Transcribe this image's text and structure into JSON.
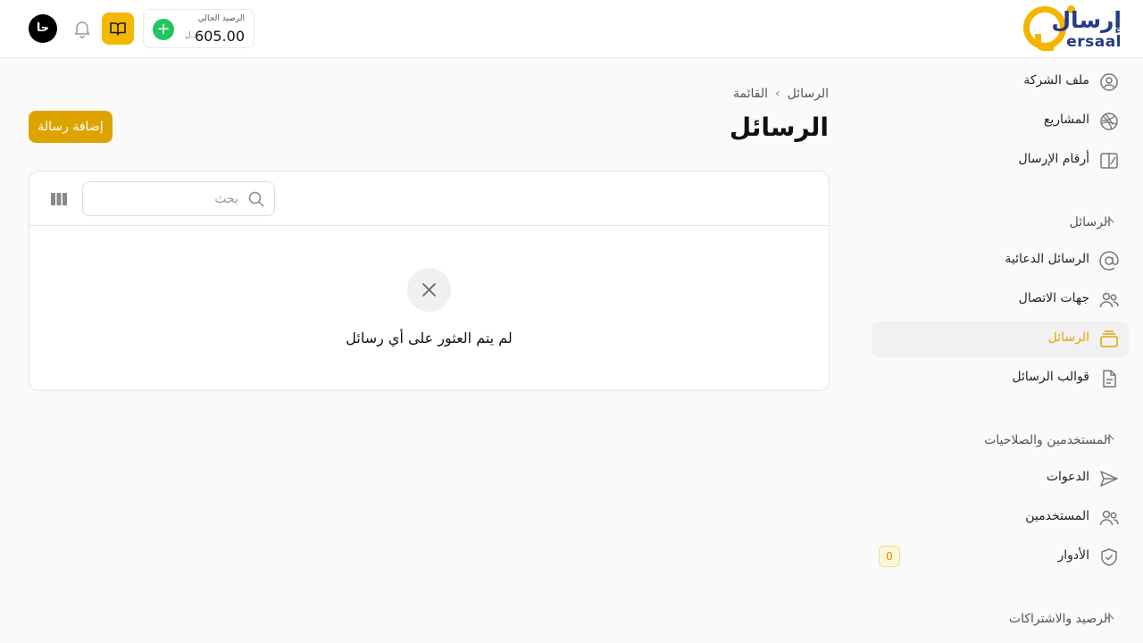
{
  "header": {
    "logo_ar": "إرسال",
    "logo_en": "ersaal",
    "balance_label": "الرصيد الحالي",
    "balance_value": "605.00",
    "currency": "د.ل",
    "avatar_initials": "حا",
    "accent_color": "#f5b800"
  },
  "sidebar": {
    "top_items": [
      {
        "label": "ملف الشركة",
        "icon": "user-circle-icon"
      },
      {
        "label": "المشاريع",
        "icon": "dribbble-icon"
      },
      {
        "label": "أرقام الإرسال",
        "icon": "sender-numbers-icon"
      }
    ],
    "sections": [
      {
        "title": "الرسائل",
        "items": [
          {
            "label": "الرسائل الدعائية",
            "icon": "at-sign-icon"
          },
          {
            "label": "جهات الاتصال",
            "icon": "users-icon"
          },
          {
            "label": "الرسائل",
            "icon": "inbox-stack-icon",
            "active": true
          },
          {
            "label": "قوالب الرسائل",
            "icon": "file-text-icon"
          }
        ]
      },
      {
        "title": "المستخدمين والصلاحيات",
        "items": [
          {
            "label": "الدعوات",
            "icon": "send-icon"
          },
          {
            "label": "المستخدمين",
            "icon": "users-icon"
          },
          {
            "label": "الأدوار",
            "icon": "shield-check-icon",
            "badge": "0"
          }
        ]
      },
      {
        "title": "الرصيد والاشتراكات",
        "items": []
      }
    ]
  },
  "main": {
    "breadcrumb": [
      "الرسائل",
      "القائمة"
    ],
    "title": "الرسائل",
    "add_button": "إضافة رسالة",
    "search_placeholder": "بحث",
    "empty_message": "لم يتم العثور على أي رسائل"
  }
}
